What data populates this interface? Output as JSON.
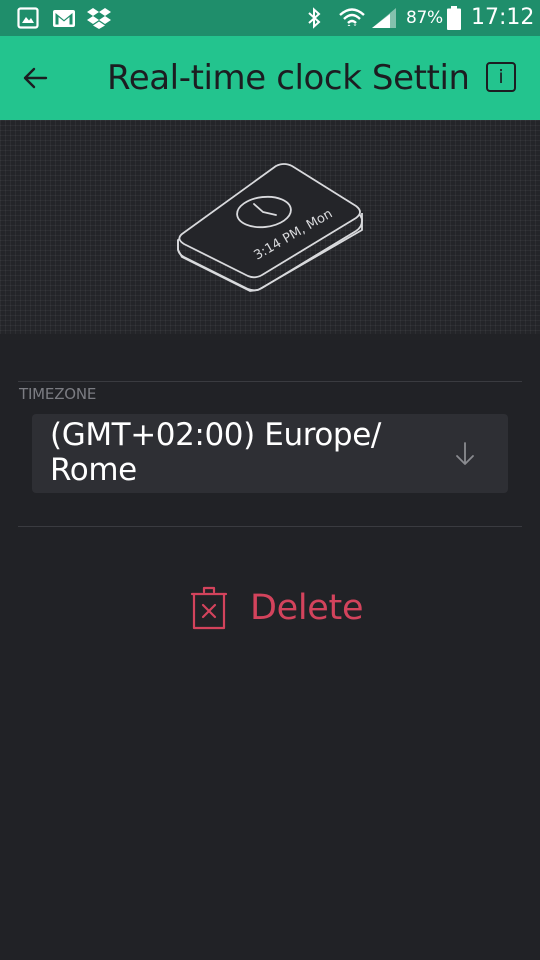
{
  "status_bar": {
    "left_icons": [
      "gallery-icon",
      "gmail-icon",
      "dropbox-icon"
    ],
    "right_icons": [
      "bluetooth-icon",
      "wifi-icon",
      "cell-signal-icon",
      "battery-icon"
    ],
    "battery": "87%",
    "time": "17:12",
    "colors": {
      "background": "#1f8e6b"
    }
  },
  "app_bar": {
    "title": "Real-time clock Settings",
    "back_icon": "arrow-left-icon",
    "info_icon": "info-icon",
    "info_label": "i",
    "colors": {
      "background": "#23c48e",
      "text": "#1c1d21"
    }
  },
  "hero": {
    "device_text": "3:14 PM, Mon",
    "icon": "clock-device-illustration"
  },
  "timezone": {
    "label": "TIMEZONE",
    "value": "(GMT+02:00) Europe/ Rome",
    "arrow_icon": "arrow-down-icon"
  },
  "delete": {
    "label": "Delete",
    "icon": "trash-icon",
    "color": "#d3435c"
  },
  "colors": {
    "page_background": "#212226",
    "field_background": "#2e2f34",
    "label": "#7b7c82"
  }
}
